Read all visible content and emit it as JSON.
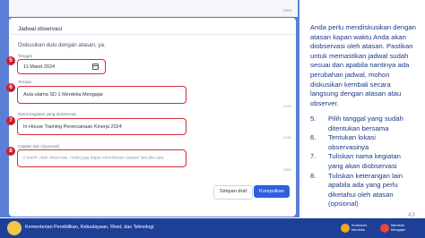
{
  "form": {
    "top_counter": "0/500",
    "section_title": "Jadwal observasi",
    "description": "Diskusikan dulu dengan atasan, ya.",
    "fields": [
      {
        "badge": "5",
        "label": "Tanggal",
        "value": "11 Maret 2024",
        "counter": ""
      },
      {
        "badge": "6",
        "label": "Tempat",
        "value": "Aula utama SD 1 Merdeka Mengajar",
        "counter": "0/100"
      },
      {
        "badge": "7",
        "label": "Nama kegiatan yang diobservasi",
        "value": "In House Training Perencanaan Kinerja 2024",
        "counter": "0/100"
      },
      {
        "badge": "8",
        "label": "Catatan lain (Opsional)",
        "placeholder": "Contoh: Alan observasi. Anda juga dapat menuliskan catatan lain jika ada.",
        "counter": "0/500"
      }
    ],
    "buttons": {
      "draft": "Simpan draf",
      "submit": "Kumpulkan"
    }
  },
  "instructions": {
    "intro": "Anda perlu mendiskusikan dengan atasan kapan waktu Anda akan diobservasi oleh atasan. Pastikan untuk memastikan jadwal sudah sesuai dan apabila nantinya ada perubahan jadwal, mohon diskusikan kembali secara langsung dengan atasan atau observer.",
    "steps": [
      {
        "num": "5.",
        "text": "Pilih tanggal yang sudah ditentukan bersama"
      },
      {
        "num": "6.",
        "text": "Tentukan lokasi observasinya"
      },
      {
        "num": "7.",
        "text": "Tuliskan nama kegiatan yang akan diobservasi"
      },
      {
        "num": "8.",
        "text": "Tuliskan keterangan lain apabila ada yang perlu diketahui oleh atasan (opsional)"
      }
    ]
  },
  "page_number": "43",
  "footer": {
    "ministry": "Kementerian Pendidikan, Kebudayaan, Riset, dan Teknologi",
    "brand1": "Kurikulum\nMerdeka",
    "brand2": "Merdeka\nMengajar"
  },
  "colors": {
    "accent_blue": "#2f5fe0",
    "highlight_red": "#d52b3a",
    "footer_blue": "#1d3f95",
    "text_blue": "#1c3a8a"
  }
}
